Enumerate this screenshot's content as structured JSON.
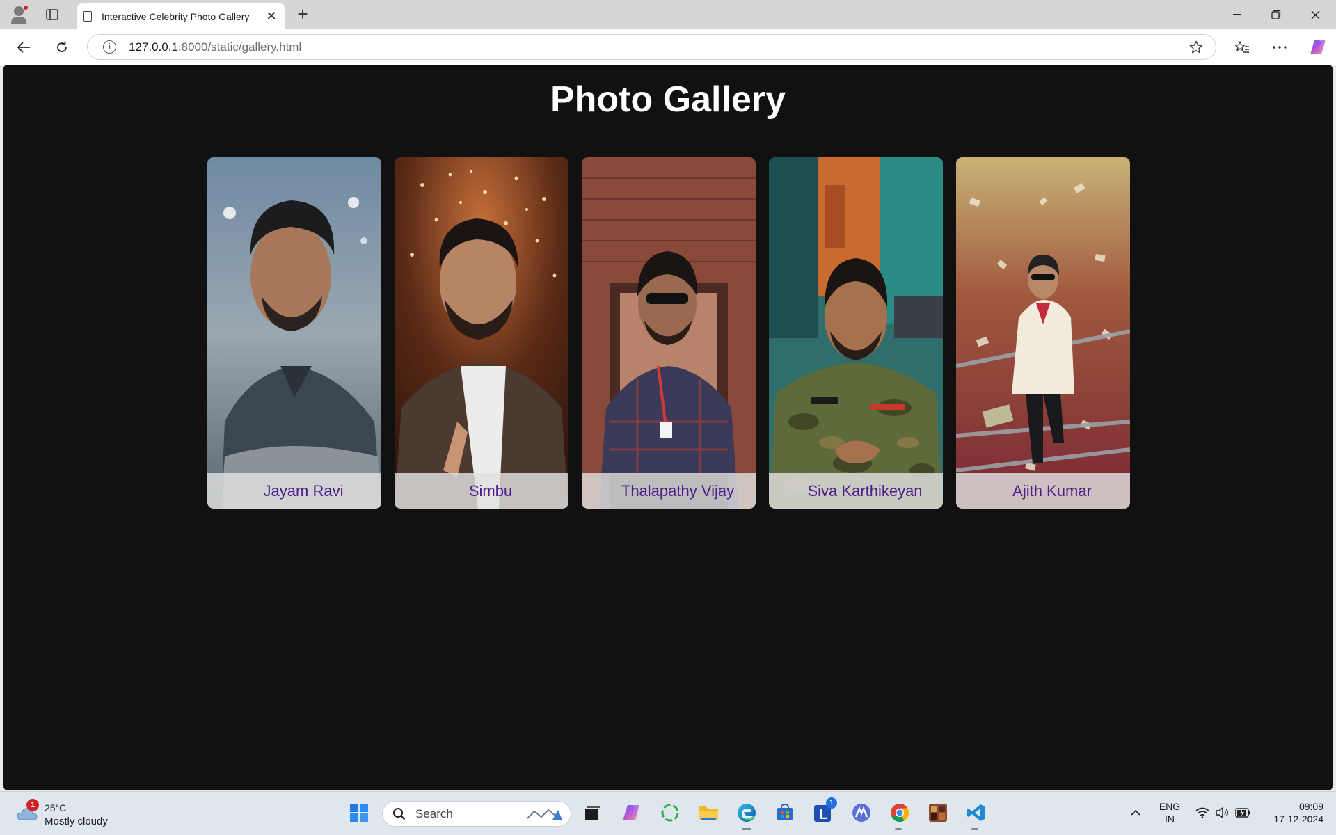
{
  "browser": {
    "tab_title": "Interactive Celebrity Photo Gallery",
    "url_host": "127.0.0.1",
    "url_rest": ":8000/static/gallery.html"
  },
  "page": {
    "title": "Photo Gallery",
    "celebrities": [
      {
        "name": "Jayam Ravi"
      },
      {
        "name": "Simbu"
      },
      {
        "name": "Thalapathy Vijay"
      },
      {
        "name": "Siva Karthikeyan"
      },
      {
        "name": "Ajith Kumar"
      }
    ]
  },
  "taskbar": {
    "weather_temp": "25°C",
    "weather_condition": "Mostly cloudy",
    "weather_badge": "1",
    "search_placeholder": "Search",
    "language_line1": "ENG",
    "language_line2": "IN",
    "time": "09:09",
    "date": "17-12-2024",
    "lens_badge": "1"
  },
  "colors": {
    "page_background": "#111111",
    "caption_text": "#4b1c8a",
    "title_text": "#ffffff"
  }
}
